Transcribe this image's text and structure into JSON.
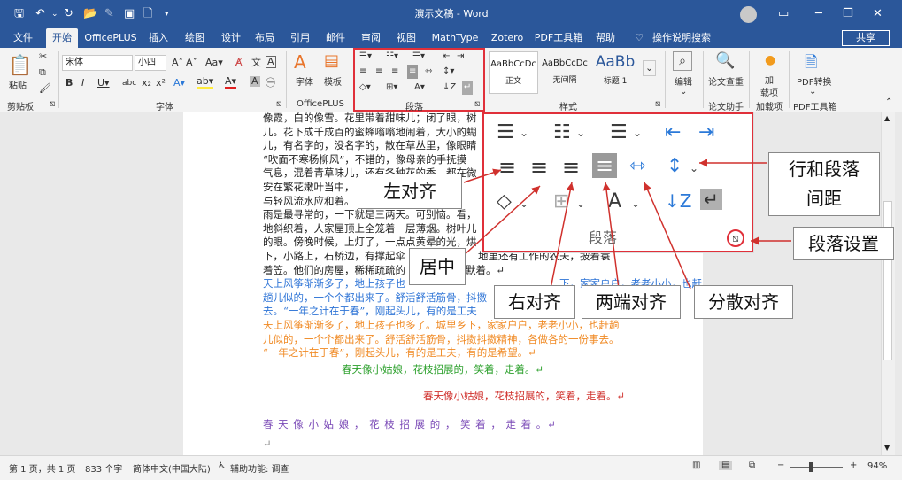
{
  "title": {
    "text": "演示文稿 - Word"
  },
  "tabs": [
    "文件",
    "开始",
    "OfficePLUS",
    "插入",
    "绘图",
    "设计",
    "布局",
    "引用",
    "邮件",
    "审阅",
    "视图",
    "MathType",
    "Zotero",
    "PDF工具箱",
    "帮助"
  ],
  "tell_me": "操作说明搜索",
  "share": "共享",
  "ribbon": {
    "groups": {
      "clipboard": "剪贴板",
      "font": "字体",
      "officeplus": "OfficePLUS",
      "paragraph": "段落",
      "styles": "样式",
      "writing": "论文助手",
      "addins": "加载项",
      "pdf": "PDF工具箱"
    },
    "paste": "粘贴",
    "font_name": "宋体",
    "font_size": "小四",
    "font_btn": "字体",
    "template_btn": "模板",
    "styles": [
      {
        "preview": "AaBbCcDc",
        "name": "正文"
      },
      {
        "preview": "AaBbCcDc",
        "name": "无间隔"
      },
      {
        "preview": "AaBb",
        "name": "标题 1"
      }
    ],
    "edit": "编辑",
    "check": "论文查重",
    "addin": "加\n载项",
    "addin_1": "加",
    "addin_2": "载项",
    "pdf_convert": "PDF转换"
  },
  "doc": {
    "black_lines": [
      "像霞，白的像雪。花里带着甜味儿；闭了眼，树",
      "儿。花下成千成百的蜜蜂嗡嗡地闹着，大小的蝴",
      "儿，有名字的，没名字的，散在草丛里，像眼睛",
      "“吹面不寒杨柳风”，不错的，像母亲的手抚摸",
      "气息，混着青草味儿，还有各种花的香，都在微",
      "安在繁花嫩叶当中，",
      "与轻风流水应和着。",
      "雨是最寻常的，一下就是三两天。可别恼。看，",
      "地斜织着，人家屋顶上全笼着一层薄烟。树叶儿",
      "的眼。傍晚时候，上灯了，一点点黄晕的光，烘",
      "下，小路上，石桥边，有撑起伞",
      "着笠。他们的房屋，稀稀疏疏的"
    ],
    "black_tails": [
      "地里还有工作的农夫，披着蓑",
      "在雨里静默着。↵"
    ],
    "blue_lines": [
      "天上风筝渐渐多了，地上孩子也",
      "趟儿似的，一个个都出来了。舒活舒活筋骨，抖擞",
      "去。“一年之计在于春”，刚起头儿，有的是工夫"
    ],
    "blue_tails": [
      "下，家家户户，老老小小，也赶"
    ],
    "orange_lines": [
      "天上风筝渐渐多了，地上孩子也多了。城里乡下，家家户户，老老小小，也赶趟",
      "儿似的，一个个都出来了。舒活舒活筋骨，抖擞抖擞精神，各做各的一份事去。",
      "“一年之计在于春”，刚起头儿，有的是工夫，有的是希望。↵"
    ],
    "green_line": "春天像小姑娘，花枝招展的，笑着，走着。↵",
    "red_line": "春天像小姑娘，花枝招展的，笑着，走着。↵",
    "purple_line": "春 天 像 小 姑 娘 ， 花 枝 招 展 的 ， 笑 着 ， 走 着 。↵",
    "mark": "↵"
  },
  "zoom_panel_label": "段落",
  "callouts": {
    "left": "左对齐",
    "center": "居中",
    "right": "右对齐",
    "justify": "两端对齐",
    "distributed": "分散对齐",
    "spacing": "行和段落\n间距",
    "spacing_1": "行和段落",
    "spacing_2": "间距",
    "settings": "段落设置"
  },
  "status": {
    "page": "第 1 页，共 1 页",
    "words": "833 个字",
    "lang": "简体中文(中国大陆)",
    "access": "辅助功能: 调查",
    "zoom": "94%"
  },
  "colors": {
    "brand": "#2b579a",
    "highlight": "#e0303a",
    "blue_text": "#2e74d6",
    "orange_text": "#f08a24",
    "green_text": "#2ca02c",
    "red_text": "#d0312d",
    "purple_text": "#7b4bb7"
  }
}
